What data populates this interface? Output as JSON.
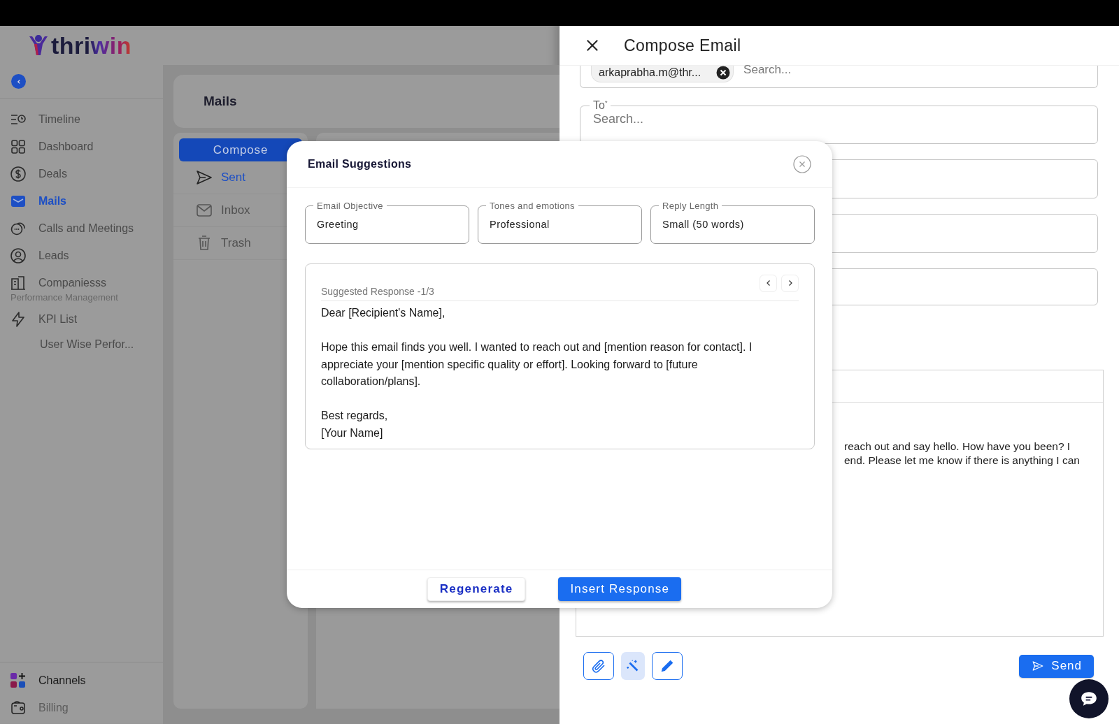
{
  "logo": {
    "text": "thriwin"
  },
  "sidebar": {
    "items": [
      {
        "label": "Timeline",
        "selected": false
      },
      {
        "label": "Dashboard",
        "selected": false
      },
      {
        "label": "Deals",
        "selected": false
      },
      {
        "label": "Mails",
        "selected": true
      },
      {
        "label": "Calls and Meetings",
        "selected": false
      },
      {
        "label": "Leads",
        "selected": false
      },
      {
        "label": "Companiesss",
        "selected": false
      }
    ],
    "section": {
      "label": "Performance Management",
      "items": [
        {
          "label": "KPI List",
          "selected": false,
          "children": [
            {
              "label": "User Wise Perfor...",
              "selected": false
            }
          ]
        }
      ]
    },
    "bottom_items": [
      {
        "label": "Channels",
        "selected": false
      },
      {
        "label": "Billing",
        "selected": false
      }
    ]
  },
  "page": {
    "title": "Mails"
  },
  "folders": {
    "compose_button": "Compose",
    "items": [
      {
        "label": "Sent",
        "selected": true
      },
      {
        "label": "Inbox",
        "selected": false
      },
      {
        "label": "Trash",
        "selected": false
      }
    ]
  },
  "compose": {
    "title": "Compose Email",
    "from_field": {
      "chip": "arkaprabha.m@thr...",
      "placeholder": "Search..."
    },
    "to_field": {
      "label": "To$^{*}$",
      "placeholder": "Search..."
    },
    "body_lines": [
      "reach out and say hello. How have you been? I",
      "end. Please let me know if there is anything I can"
    ],
    "tools": [
      {
        "selected": false
      },
      {
        "selected": true
      },
      {
        "selected": false
      }
    ],
    "send_button": "Send"
  },
  "suggestions_dialog": {
    "title": "Email Suggestions",
    "fields": [
      {
        "label": "Email Objective",
        "value": "Greeting"
      },
      {
        "label": "Tones and emotions",
        "value": "Professional"
      },
      {
        "label": "Reply Length",
        "value": "Small (50 words)"
      }
    ],
    "response": {
      "heading": "Suggested Response -1/3",
      "paragraphs": [
        "Dear [Recipient's Name],",
        "Hope this email finds you well. I wanted to reach out and [mention reason for contact]. I appreciate your [mention specific quality or effort]. Looking forward to [future collaboration/plans].",
        "Best regards,\n[Your Name]"
      ]
    },
    "buttons": [
      {
        "label": "Regenerate",
        "kind": "secondary"
      },
      {
        "label": "Insert Response",
        "kind": "primary"
      }
    ]
  }
}
